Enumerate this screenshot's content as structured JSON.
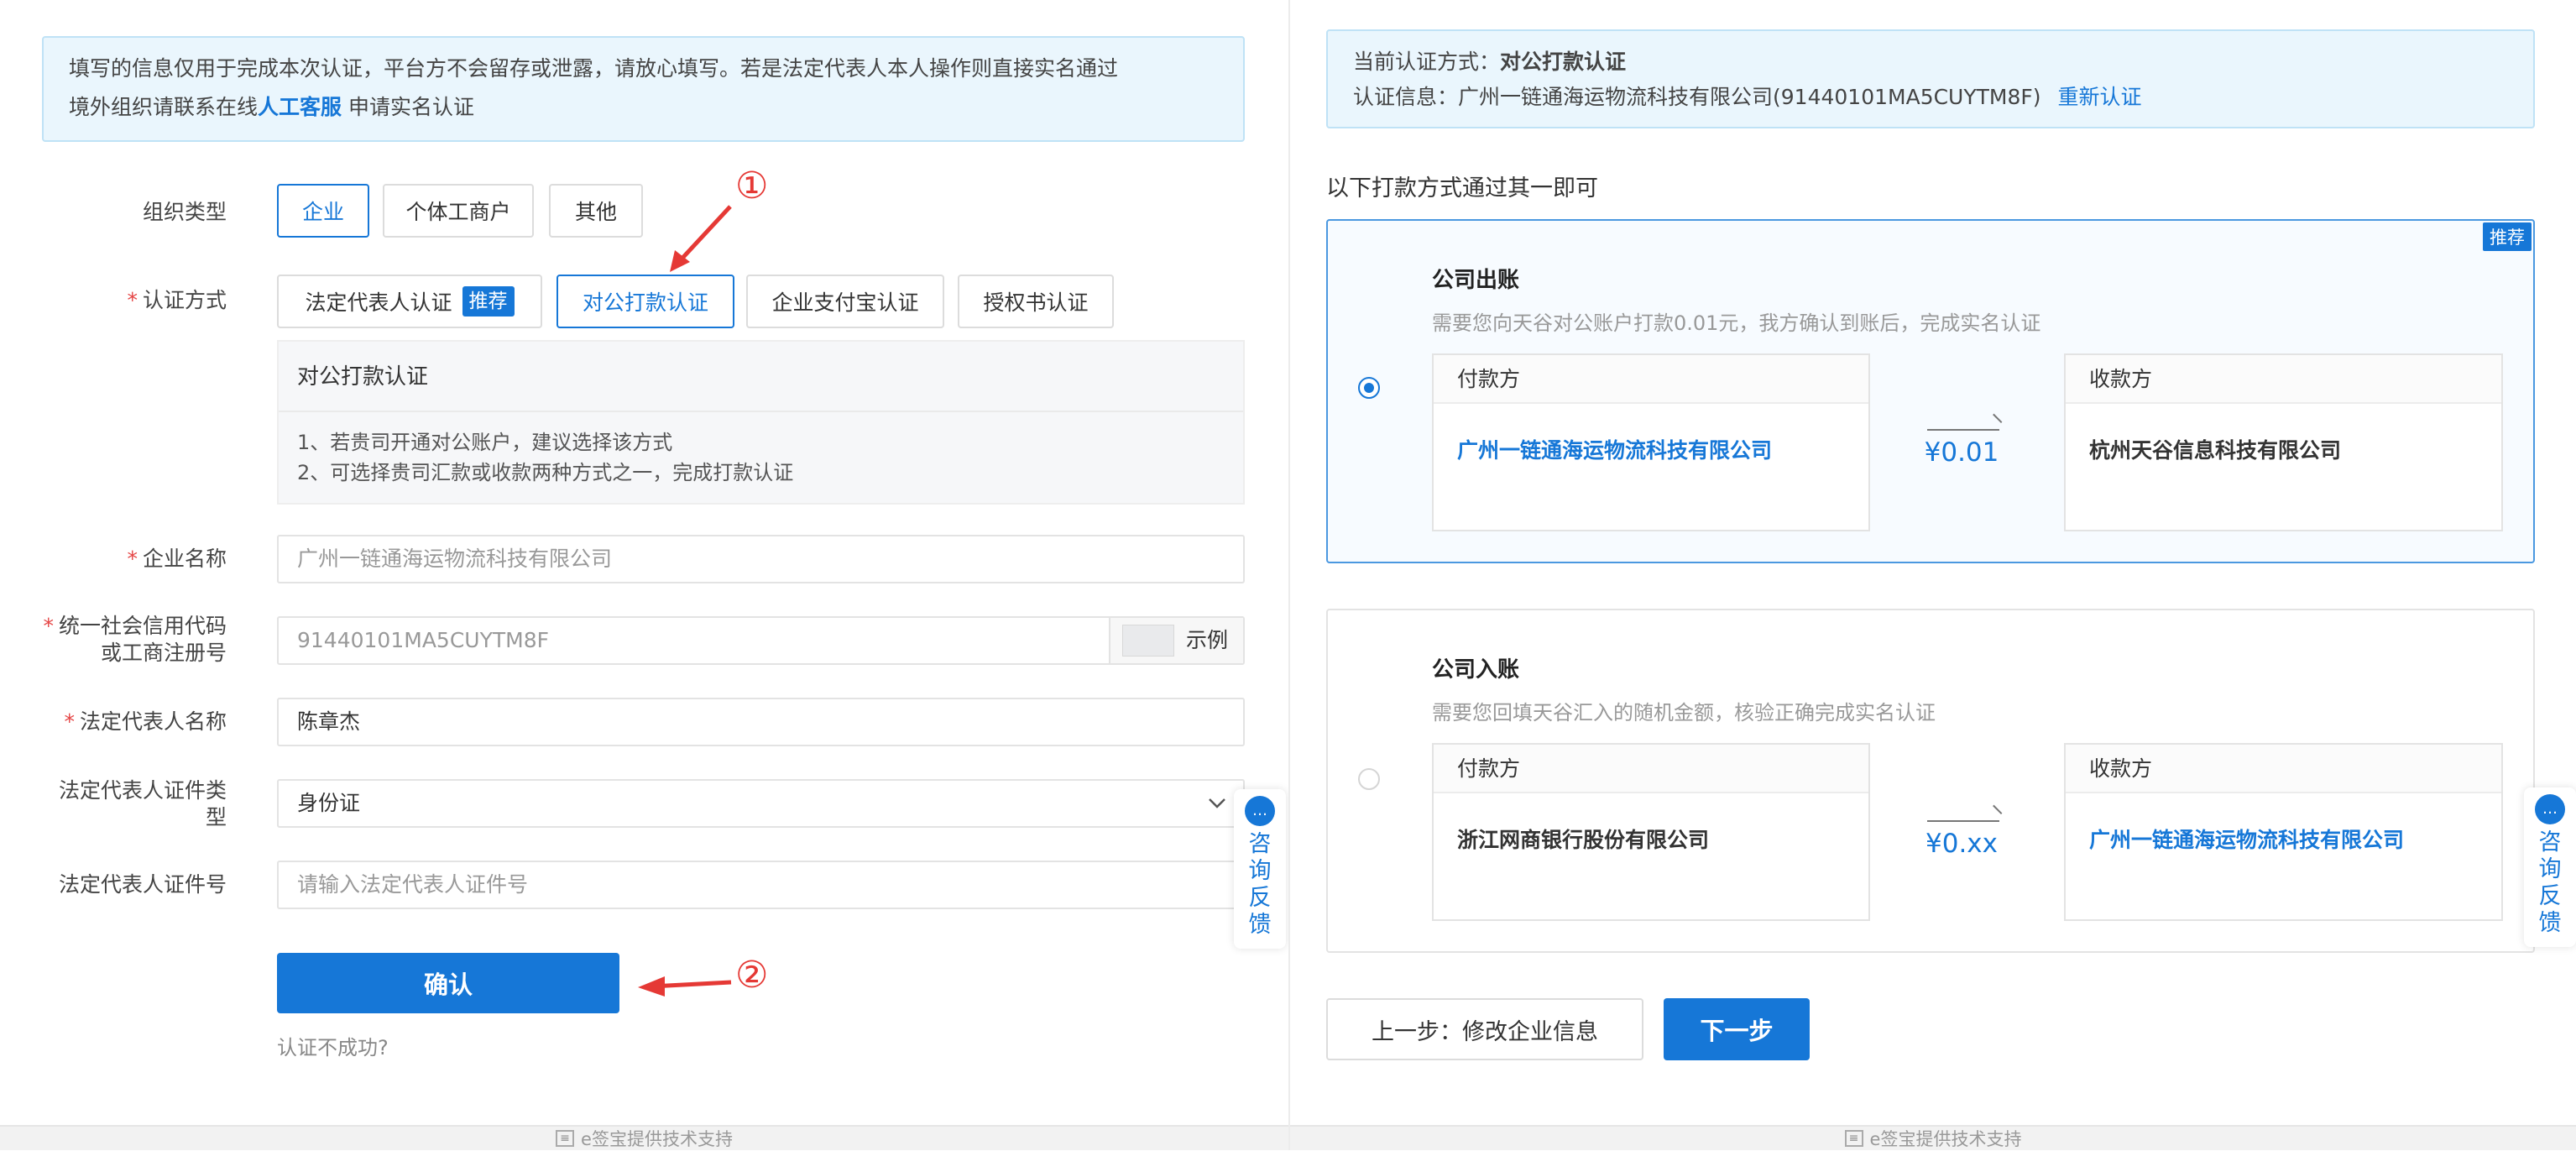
{
  "left": {
    "notice": {
      "line1": "填写的信息仅用于完成本次认证，平台方不会留存或泄露，请放心填写。若是法定代表人本人操作则直接实名通过",
      "line2_prefix": "境外组织请联系在线",
      "line2_link": "人工客服",
      "line2_suffix": "申请实名认证"
    },
    "org_type": {
      "label": "组织类型",
      "options": [
        "企业",
        "个体工商户",
        "其他"
      ],
      "selected": "企业"
    },
    "auth_method": {
      "label": "认证方式",
      "options": [
        {
          "label": "法定代表人认证",
          "tag": "推荐"
        },
        {
          "label": "对公打款认证"
        },
        {
          "label": "企业支付宝认证"
        },
        {
          "label": "授权书认证"
        }
      ],
      "selected": "对公打款认证"
    },
    "info_box": {
      "title": "对公打款认证",
      "line1": "1、若贵司开通对公账户，建议选择该方式",
      "line2": "2、可选择贵司汇款或收款两种方式之一，完成打款认证"
    },
    "fields": {
      "company_name": {
        "label": "企业名称",
        "value": "广州一链通海运物流科技有限公司"
      },
      "credit_code": {
        "label_line1": "统一社会信用代码",
        "label_line2": "或工商注册号",
        "value": "91440101MA5CUYTM8F",
        "example": "示例"
      },
      "legal_rep_name": {
        "label": "法定代表人名称",
        "value": "陈章杰"
      },
      "id_type": {
        "label_line1": "法定代表人证件类",
        "label_line2": "型",
        "value": "身份证"
      },
      "id_number": {
        "label": "法定代表人证件号",
        "placeholder": "请输入法定代表人证件号"
      }
    },
    "confirm_button": "确认",
    "fail_link": "认证不成功?",
    "annotation_1": "①",
    "annotation_2": "②",
    "float_button": {
      "icon": "💬",
      "chars": [
        "咨",
        "询",
        "反",
        "馈"
      ]
    },
    "footer": "e签宝提供技术支持"
  },
  "right": {
    "current_method_prefix": "当前认证方式：",
    "current_method": "对公打款认证",
    "auth_info_prefix": "认证信息：",
    "auth_info": "广州一链通海运物流科技有限公司(91440101MA5CUYTM8F)",
    "reauth_link": "重新认证",
    "instruction": "以下打款方式通过其一即可",
    "options": [
      {
        "title": "公司出账",
        "desc": "需要您向天谷对公账户打款0.01元，我方确认到账后，完成实名认证",
        "payer_label": "付款方",
        "payer": "广州一链通海运物流科技有限公司",
        "amount": "¥0.01",
        "payee_label": "收款方",
        "payee": "杭州天谷信息科技有限公司",
        "badge": "推荐",
        "selected": true
      },
      {
        "title": "公司入账",
        "desc": "需要您回填天谷汇入的随机金额，核验正确完成实名认证",
        "payer_label": "付款方",
        "payer": "浙江网商银行股份有限公司",
        "amount": "¥0.xx",
        "payee_label": "收款方",
        "payee": "广州一链通海运物流科技有限公司",
        "selected": false
      }
    ],
    "prev_button": "上一步：修改企业信息",
    "next_button": "下一步",
    "float_button": {
      "icon": "💬",
      "chars": [
        "咨",
        "询",
        "反",
        "馈"
      ]
    },
    "footer": "e签宝提供技术支持"
  },
  "colors": {
    "accent": "#1677d7",
    "notice_bg": "#eaf6fd",
    "required": "#e54545",
    "annotation": "#e53935"
  }
}
